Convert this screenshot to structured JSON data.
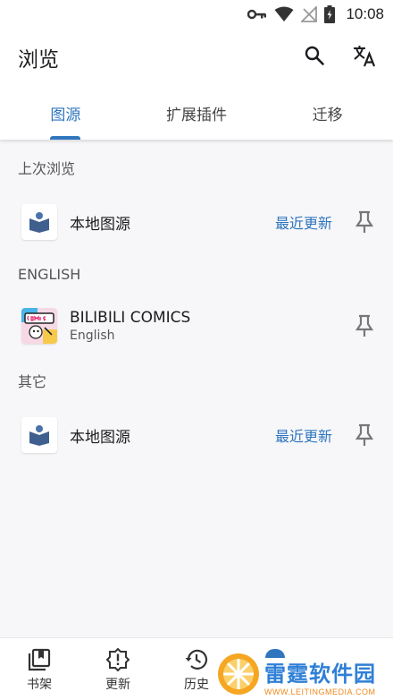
{
  "status_bar": {
    "time": "10:08",
    "icons": [
      "key-icon",
      "wifi-icon",
      "no-signal-icon",
      "battery-icon"
    ]
  },
  "app_bar": {
    "title": "浏览",
    "actions": [
      "search-icon",
      "translate-icon"
    ]
  },
  "tabs": [
    {
      "label": "图源",
      "active": true
    },
    {
      "label": "扩展插件",
      "active": false
    },
    {
      "label": "迁移",
      "active": false
    }
  ],
  "sections": [
    {
      "header": "上次浏览",
      "items": [
        {
          "name": "本地图源",
          "latest": "最近更新",
          "icon": "local-source-icon",
          "pin": "pin-icon"
        }
      ]
    },
    {
      "header": "ENGLISH",
      "items": [
        {
          "name": "BILIBILI COMICS",
          "language": "English",
          "icon": "bilibili-comics-logo",
          "pin": "pin-icon"
        }
      ]
    },
    {
      "header": "其它",
      "items": [
        {
          "name": "本地图源",
          "latest": "最近更新",
          "icon": "local-source-icon",
          "pin": "pin-icon"
        }
      ]
    }
  ],
  "bottom_nav": [
    {
      "label": "书架",
      "icon": "bookshelf-icon"
    },
    {
      "label": "更新",
      "icon": "updates-icon"
    },
    {
      "label": "历史",
      "icon": "history-icon"
    }
  ],
  "watermark": {
    "main": "雷霆软件园",
    "sub": "WWW.LEITINGMEDIA.COM"
  },
  "colors": {
    "accent": "#2f76bf",
    "background": "#f7f7f9",
    "surface": "#ffffff"
  }
}
